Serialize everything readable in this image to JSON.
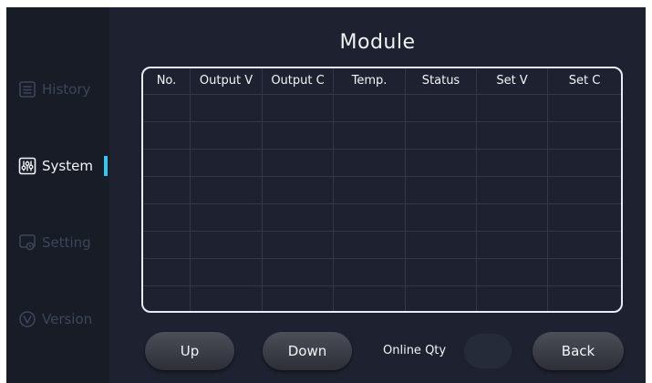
{
  "sidebar": {
    "items": [
      {
        "label": "History",
        "icon": "history-icon",
        "active": false
      },
      {
        "label": "System",
        "icon": "system-sliders-icon",
        "active": true
      },
      {
        "label": "Setting",
        "icon": "setting-icon",
        "active": false
      },
      {
        "label": "Version",
        "icon": "version-icon",
        "active": false
      }
    ]
  },
  "main": {
    "title": "Module",
    "table": {
      "columns": [
        "No.",
        "Output V",
        "Output C",
        "Temp.",
        "Status",
        "Set V",
        "Set C"
      ],
      "rows": [
        [
          "",
          "",
          "",
          "",
          "",
          "",
          ""
        ],
        [
          "",
          "",
          "",
          "",
          "",
          "",
          ""
        ],
        [
          "",
          "",
          "",
          "",
          "",
          "",
          ""
        ],
        [
          "",
          "",
          "",
          "",
          "",
          "",
          ""
        ],
        [
          "",
          "",
          "",
          "",
          "",
          "",
          ""
        ],
        [
          "",
          "",
          "",
          "",
          "",
          "",
          ""
        ],
        [
          "",
          "",
          "",
          "",
          "",
          "",
          ""
        ],
        [
          "",
          "",
          "",
          "",
          "",
          "",
          ""
        ]
      ]
    },
    "buttons": {
      "up": "Up",
      "down": "Down",
      "back": "Back"
    },
    "online_qty": {
      "label": "Online Qty",
      "value": ""
    }
  },
  "colors": {
    "background": "#1e2230",
    "sidebar_background": "#181c27",
    "accent": "#34c6f2",
    "inactive_text": "#3d4559",
    "active_text": "#f2f4f8"
  }
}
